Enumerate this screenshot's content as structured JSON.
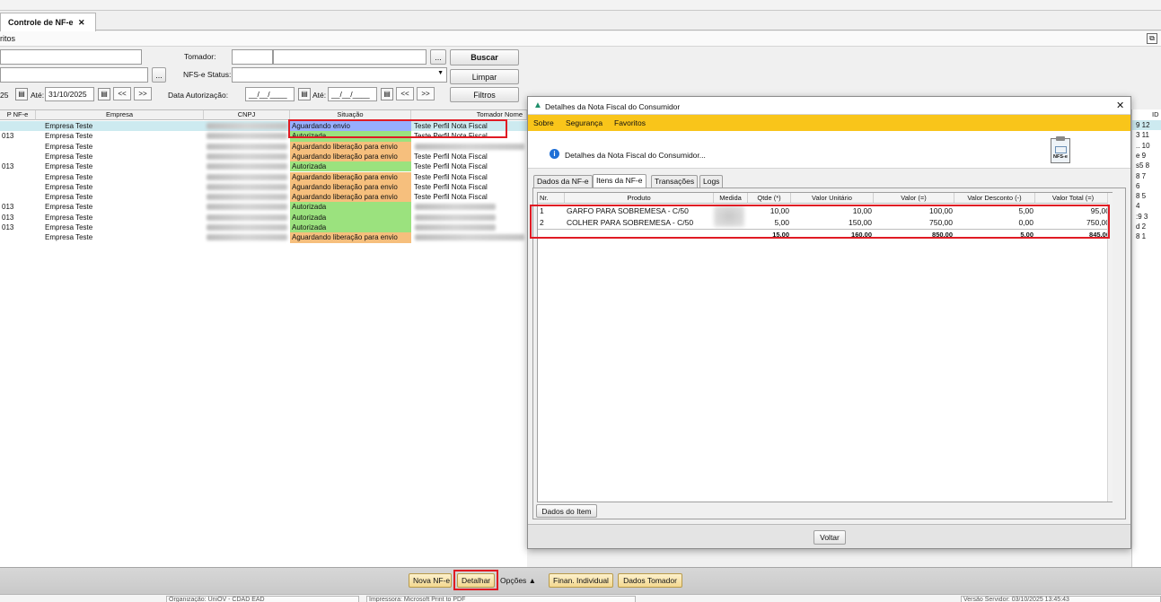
{
  "tab": {
    "title": "Controle de NF-e",
    "close": "✕"
  },
  "favorites_label": "ritos",
  "filters": {
    "tomador_label": "Tomador:",
    "nfse_status_label": "NFS-e Status:",
    "date_from": "25",
    "ate_label": "Até:",
    "date_to": "31/10/2025",
    "data_autorizacao_label": "Data Autorização:",
    "aut_from": "__/__/____",
    "aut_to": "__/__/____",
    "ellipsis": "...",
    "nav_prev": "<<",
    "nav_next": ">>",
    "buscar": "Buscar",
    "limpar": "Limpar",
    "filtros": "Filtros"
  },
  "grid": {
    "headers": [
      "P NF-e",
      "Empresa",
      "CNPJ",
      "Situação",
      "Tomador Nome"
    ],
    "rows": [
      {
        "nf": "",
        "empresa": "Empresa Teste",
        "situacao": "Aguardando envio",
        "tomador": "Teste Perfil Nota Fiscal",
        "status": "aguardando"
      },
      {
        "nf": "013",
        "empresa": "Empresa Teste",
        "situacao": "Autorizada",
        "tomador": "Teste Perfil Nota Fiscal",
        "status": "autorizada"
      },
      {
        "nf": "",
        "empresa": "Empresa Teste",
        "situacao": "Aguardando liberação para envio",
        "tomador": "",
        "status": "liberacao"
      },
      {
        "nf": "",
        "empresa": "Empresa Teste",
        "situacao": "Aguardando liberação para envio",
        "tomador": "Teste Perfil Nota Fiscal",
        "status": "liberacao"
      },
      {
        "nf": "013",
        "empresa": "Empresa Teste",
        "situacao": "Autorizada",
        "tomador": "Teste Perfil Nota Fiscal",
        "status": "autorizada"
      },
      {
        "nf": "",
        "empresa": "Empresa Teste",
        "situacao": "Aguardando liberação para envio",
        "tomador": "Teste Perfil Nota Fiscal",
        "status": "liberacao"
      },
      {
        "nf": "",
        "empresa": "Empresa Teste",
        "situacao": "Aguardando liberação para envio",
        "tomador": "Teste Perfil Nota Fiscal",
        "status": "liberacao"
      },
      {
        "nf": "",
        "empresa": "Empresa Teste",
        "situacao": "Aguardando liberação para envio",
        "tomador": "Teste Perfil Nota Fiscal",
        "status": "liberacao"
      },
      {
        "nf": "013",
        "empresa": "Empresa Teste",
        "situacao": "Autorizada",
        "tomador": "",
        "status": "autorizada"
      },
      {
        "nf": "013",
        "empresa": "Empresa Teste",
        "situacao": "Autorizada",
        "tomador": "",
        "status": "autorizada"
      },
      {
        "nf": "013",
        "empresa": "Empresa Teste",
        "situacao": "Autorizada",
        "tomador": "",
        "status": "autorizada"
      },
      {
        "nf": "",
        "empresa": "Empresa Teste",
        "situacao": "Aguardando liberação para envio",
        "tomador": "",
        "status": "liberacao"
      }
    ],
    "id_header": "ID",
    "id_values": [
      "9 12",
      "3 11",
      ".. 10",
      "e 9",
      "s5 8",
      "8 7",
      "6",
      "8 5",
      "4",
      ":9 3",
      "d 2",
      "8 1"
    ]
  },
  "colors": {
    "aguardando": "#97aeff",
    "autorizada": "#9be27e",
    "liberacao": "#f6bf7d",
    "selected_row": "#cdeaf0",
    "menu_bar": "#f9c51a",
    "highlight": "#e01b24"
  },
  "dialog": {
    "title": "Detalhes da Nota Fiscal do Consumidor",
    "close": "✕",
    "menu": [
      "Sobre",
      "Segurança",
      "Favoritos"
    ],
    "header_text": "Detalhes da Nota Fiscal do Consumidor...",
    "header_icon_label": "NFS-e",
    "tabs": [
      "Dados da NF-e",
      "Itens da NF-e",
      "Transações",
      "Logs"
    ],
    "active_tab": 1,
    "item_headers": [
      "Nr.",
      "Produto",
      "Medida",
      "Qtde (*)",
      "Valor Unitário",
      "Valor (=)",
      "Valor Desconto (-)",
      "Valor Total (=)"
    ],
    "items": [
      {
        "nr": "1",
        "produto": "GARFO PARA SOBREMESA - C/50",
        "qtde": "10,00",
        "unit": "10,00",
        "valor": "100,00",
        "desconto": "5,00",
        "total": "95,00"
      },
      {
        "nr": "2",
        "produto": "COLHER PARA SOBREMESA - C/50",
        "qtde": "5,00",
        "unit": "150,00",
        "valor": "750,00",
        "desconto": "0,00",
        "total": "750,00"
      }
    ],
    "totals": {
      "qtde": "15,00",
      "unit": "160,00",
      "valor": "850,00",
      "desconto": "5,00",
      "total": "845,00"
    },
    "item_details_button": "Dados do Item",
    "voltar": "Voltar"
  },
  "footer": {
    "buttons": [
      "Nova NF-e",
      "Detalhar",
      "Opções ▲",
      "Finan. Individual",
      "Dados Tomador"
    ]
  },
  "statusbar": {
    "org": "Organização: UniOV - CDAD EAD",
    "printer": "Impressora: Microsoft Print to PDF",
    "version": "Versão Servidor: 03/10/2025 13:45:43"
  }
}
